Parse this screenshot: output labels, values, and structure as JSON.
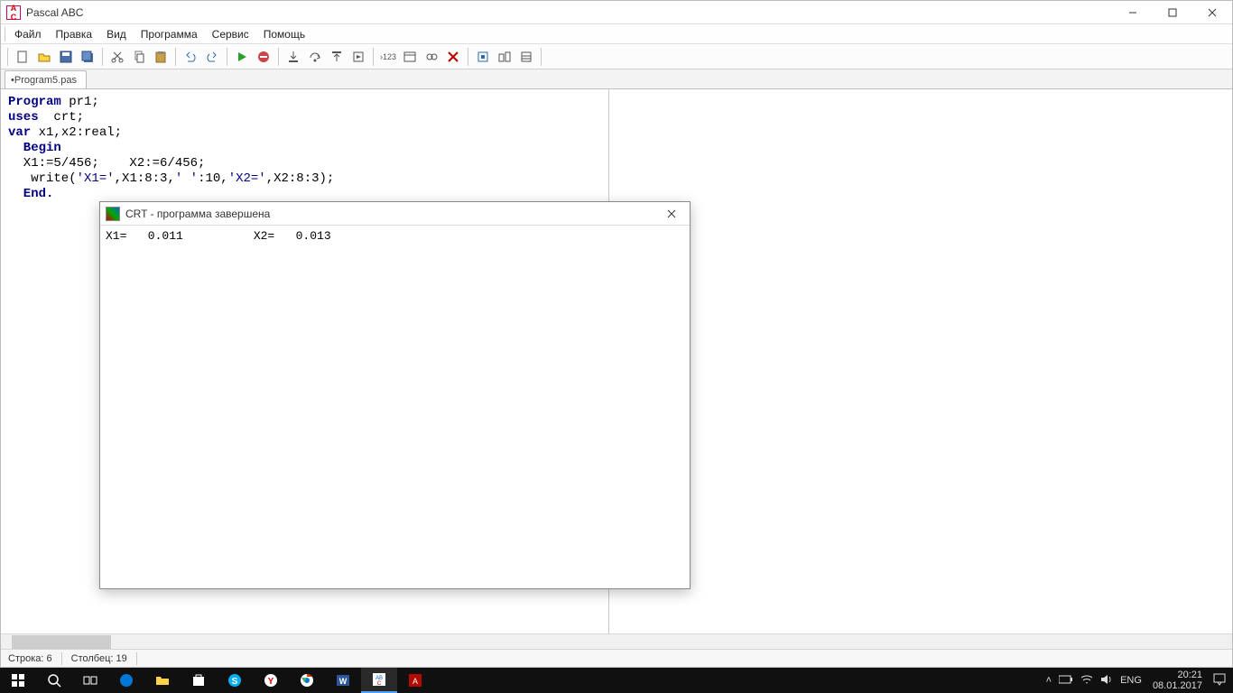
{
  "app": {
    "title": "Pascal ABC"
  },
  "menu": {
    "file": "Файл",
    "edit": "Правка",
    "view": "Вид",
    "program": "Программа",
    "service": "Сервис",
    "help": "Помощь"
  },
  "tab": {
    "name": "•Program5.pas"
  },
  "code": {
    "l1a": "Program",
    "l1b": " pr1;",
    "l2a": "uses",
    "l2b": "  crt;",
    "l3a": "var",
    "l3b": " x1,x2:real;",
    "l4": "  Begin",
    "l5": "  X1:=5/456;    X2:=6/456;",
    "l6a": "   write(",
    "l6b": "'X1='",
    "l6c": ",X1:8:3,",
    "l6d": "' '",
    "l6e": ":10,",
    "l6f": "'X2='",
    "l6g": ",X2:8:3);",
    "l7": "  End."
  },
  "crt": {
    "title": "CRT - программа завершена",
    "output": "X1=   0.011          X2=   0.013"
  },
  "status": {
    "row": "Строка: 6",
    "col": "Столбец: 19"
  },
  "tray": {
    "lang": "ENG",
    "time": "20:21",
    "date": "08.01.2017"
  }
}
